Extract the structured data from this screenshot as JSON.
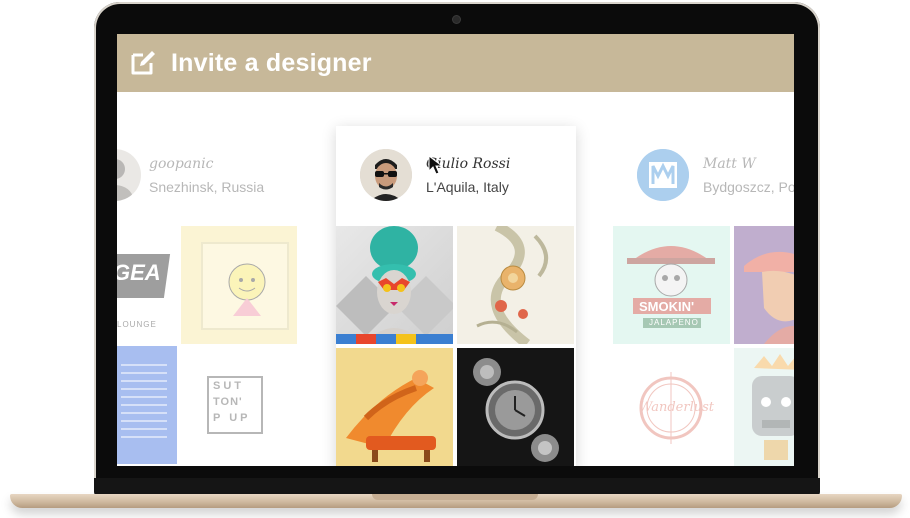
{
  "header": {
    "title": "Invite a designer",
    "icon": "edit-icon",
    "background": "#c7b899"
  },
  "designers": [
    {
      "name": "goopanic",
      "location": "Snezhinsk, Russia",
      "avatar": "avatar-photo"
    },
    {
      "name": "Giulio Rossi",
      "location": "L'Aquila, Italy",
      "avatar": "avatar-photo-sunglasses"
    },
    {
      "name": "Matt W",
      "location": "Bydgoszcz, Po",
      "avatar": "avatar-logo-m"
    }
  ],
  "artwork_text": {
    "gear_logo": "GEA",
    "lounge": "LOUNGE",
    "sut_line1": "SUT",
    "sut_line2": "TON'",
    "sut_line3": "P UP",
    "smokin": "SMOKIN'",
    "jalapeno": "JALAPENO",
    "wanderlust": "Wanderlust"
  }
}
